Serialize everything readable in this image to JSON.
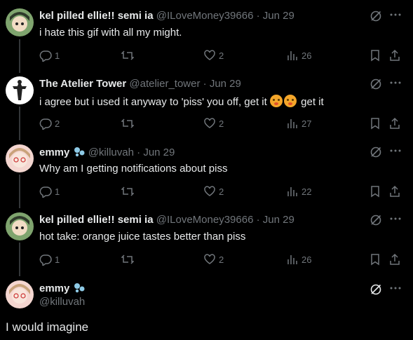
{
  "tweets": [
    {
      "name": "kel pilled ellie!! semi ia",
      "handle": "@ILoveMoney39666",
      "dot": "·",
      "date": "Jun 29",
      "text": "i hate this gif with all my might.",
      "replies": "1",
      "likes": "2",
      "views": "26"
    },
    {
      "name": "The Atelier Tower",
      "handle": "@atelier_tower",
      "dot": "·",
      "date": "Jun 29",
      "text": "i agree but i used it anyway to 'piss' you off, get it",
      "text_tail": "get it",
      "replies": "2",
      "likes": "2",
      "views": "27"
    },
    {
      "name": "emmy",
      "handle": "@killuvah",
      "dot": "·",
      "date": "Jun 29",
      "text": "Why am I getting notifications about piss",
      "replies": "1",
      "likes": "2",
      "views": "22"
    },
    {
      "name": "kel pilled ellie!! semi ia",
      "handle": "@ILoveMoney39666",
      "dot": "·",
      "date": "Jun 29",
      "text": "hot take: orange juice tastes better than piss",
      "replies": "1",
      "likes": "2",
      "views": "26"
    }
  ],
  "main_tweet": {
    "name": "emmy",
    "handle": "@killuvah",
    "text": "I would imagine"
  },
  "icons": {
    "reply": "reply-icon",
    "retweet": "retweet-icon",
    "like": "heart-icon",
    "views": "views-icon",
    "bookmark": "bookmark-icon",
    "share": "share-icon",
    "grok": "grok-icon",
    "more": "more-icon",
    "badge": "bubbles-emoji-icon",
    "emoji": "flushed-emoji-icon"
  },
  "colors": {
    "background": "#000000",
    "text": "#e7e9ea",
    "secondary": "#71767b",
    "line": "#333639"
  }
}
